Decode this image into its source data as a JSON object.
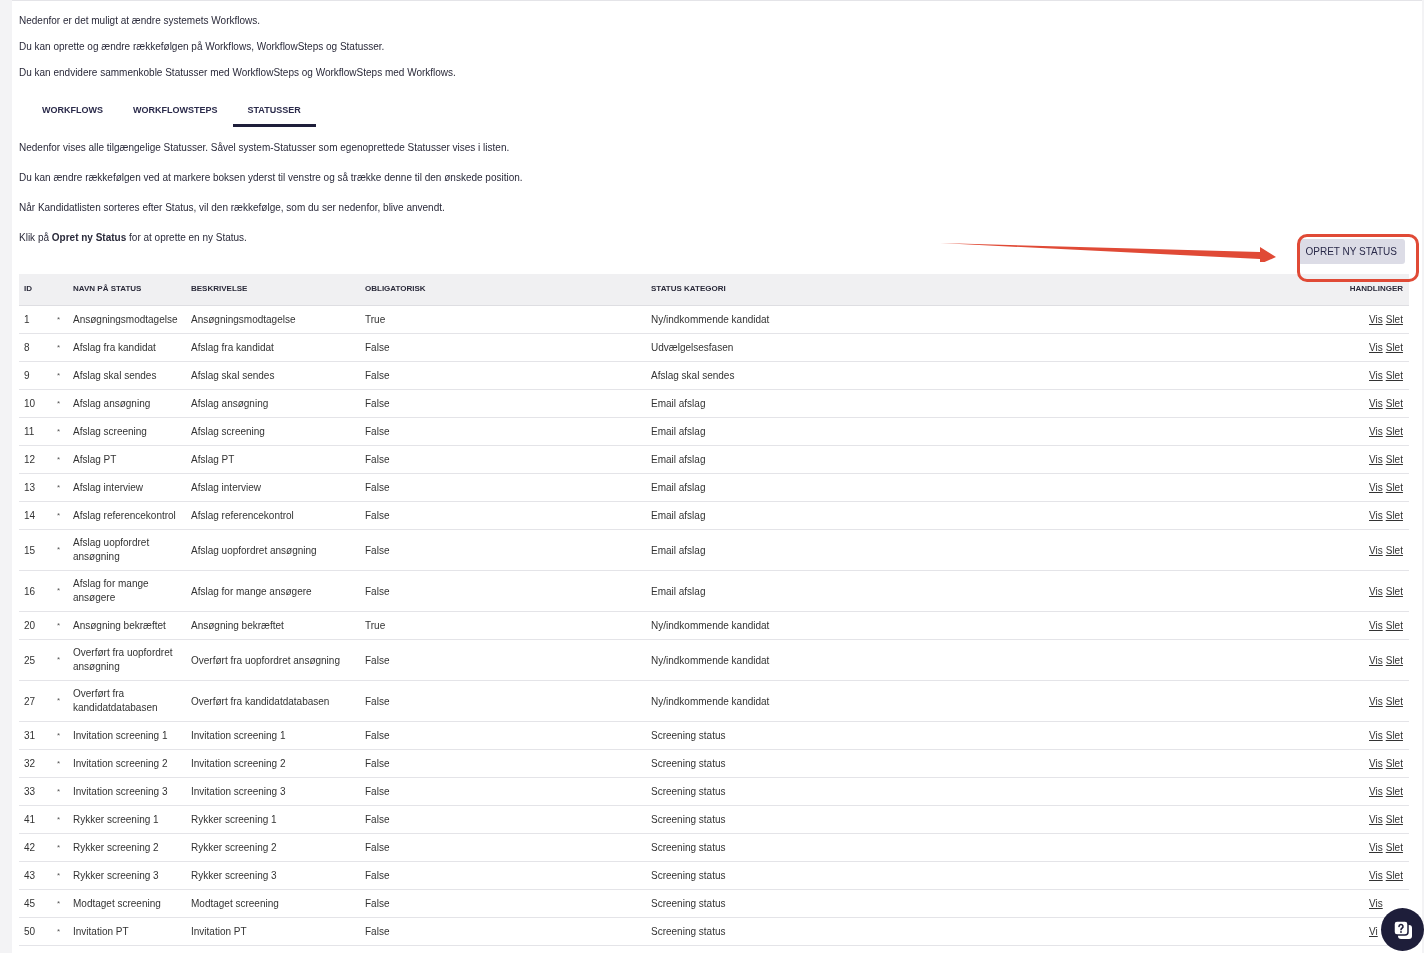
{
  "intro": [
    "Nedenfor er det muligt at ændre systemets Workflows.",
    "Du kan oprette og ændre rækkefølgen på Workflows, WorkflowSteps og Statusser.",
    "Du kan endvidere sammenkoble Statusser med WorkflowSteps og WorkflowSteps med Workflows."
  ],
  "tabs": [
    {
      "label": "WORKFLOWS",
      "selected": false
    },
    {
      "label": "WORKFLOWSTEPS",
      "selected": false
    },
    {
      "label": "STATUSSER",
      "selected": true
    }
  ],
  "description": [
    "Nedenfor vises alle tilgængelige Statusser. Såvel system-Statusser som egenoprettede Statusser vises i listen.",
    "Du kan ændre rækkefølgen ved at markere boksen yderst til venstre og så trække denne til den ønskede position.",
    "Når Kandidatlisten sorteres efter Status, vil den rækkefølge, som du ser nedenfor, blive anvendt.",
    "Klik på **Opret ny Status** for at oprette en ny Status."
  ],
  "create_button": "OPRET NY STATUS",
  "table": {
    "columns": [
      "ID",
      "NAVN PÅ STATUS",
      "BESKRIVELSE",
      "OBLIGATORISK",
      "STATUS KATEGORI",
      "HANDLINGER"
    ],
    "rows": [
      {
        "id": "1",
        "handle": "*",
        "name": "Ansøgningsmodtagelse",
        "description": "Ansøgningsmodtagelse",
        "mandatory": "True",
        "category": "Ny/indkommende kandidat",
        "actions": [
          "Vis",
          "Slet"
        ]
      },
      {
        "id": "8",
        "handle": "*",
        "name": "Afslag fra kandidat",
        "description": "Afslag fra kandidat",
        "mandatory": "False",
        "category": "Udvælgelsesfasen",
        "actions": [
          "Vis",
          "Slet"
        ]
      },
      {
        "id": "9",
        "handle": "*",
        "name": "Afslag skal sendes",
        "description": "Afslag skal sendes",
        "mandatory": "False",
        "category": "Afslag skal sendes",
        "actions": [
          "Vis",
          "Slet"
        ]
      },
      {
        "id": "10",
        "handle": "*",
        "name": "Afslag ansøgning",
        "description": "Afslag ansøgning",
        "mandatory": "False",
        "category": "Email afslag",
        "actions": [
          "Vis",
          "Slet"
        ]
      },
      {
        "id": "11",
        "handle": "*",
        "name": "Afslag screening",
        "description": "Afslag screening",
        "mandatory": "False",
        "category": "Email afslag",
        "actions": [
          "Vis",
          "Slet"
        ]
      },
      {
        "id": "12",
        "handle": "*",
        "name": "Afslag PT",
        "description": "Afslag PT",
        "mandatory": "False",
        "category": "Email afslag",
        "actions": [
          "Vis",
          "Slet"
        ]
      },
      {
        "id": "13",
        "handle": "*",
        "name": "Afslag interview",
        "description": "Afslag interview",
        "mandatory": "False",
        "category": "Email afslag",
        "actions": [
          "Vis",
          "Slet"
        ]
      },
      {
        "id": "14",
        "handle": "*",
        "name": "Afslag referencekontrol",
        "description": "Afslag referencekontrol",
        "mandatory": "False",
        "category": "Email afslag",
        "actions": [
          "Vis",
          "Slet"
        ]
      },
      {
        "id": "15",
        "handle": "*",
        "name": "Afslag uopfordret ansøgning",
        "description": "Afslag uopfordret ansøgning",
        "mandatory": "False",
        "category": "Email afslag",
        "actions": [
          "Vis",
          "Slet"
        ]
      },
      {
        "id": "16",
        "handle": "*",
        "name": "Afslag for mange ansøgere",
        "description": "Afslag for mange ansøgere",
        "mandatory": "False",
        "category": "Email afslag",
        "actions": [
          "Vis",
          "Slet"
        ]
      },
      {
        "id": "20",
        "handle": "*",
        "name": "Ansøgning bekræftet",
        "description": "Ansøgning bekræftet",
        "mandatory": "True",
        "category": "Ny/indkommende kandidat",
        "actions": [
          "Vis",
          "Slet"
        ]
      },
      {
        "id": "25",
        "handle": "*",
        "name": "Overført fra uopfordret ansøgning",
        "description": "Overført fra uopfordret ansøgning",
        "mandatory": "False",
        "category": "Ny/indkommende kandidat",
        "actions": [
          "Vis",
          "Slet"
        ]
      },
      {
        "id": "27",
        "handle": "*",
        "name": "Overført fra kandidatdatabasen",
        "description": "Overført fra kandidatdatabasen",
        "mandatory": "False",
        "category": "Ny/indkommende kandidat",
        "actions": [
          "Vis",
          "Slet"
        ]
      },
      {
        "id": "31",
        "handle": "*",
        "name": "Invitation screening 1",
        "description": "Invitation screening 1",
        "mandatory": "False",
        "category": "Screening status",
        "actions": [
          "Vis",
          "Slet"
        ]
      },
      {
        "id": "32",
        "handle": "*",
        "name": "Invitation screening 2",
        "description": "Invitation screening 2",
        "mandatory": "False",
        "category": "Screening status",
        "actions": [
          "Vis",
          "Slet"
        ]
      },
      {
        "id": "33",
        "handle": "*",
        "name": "Invitation screening 3",
        "description": "Invitation screening 3",
        "mandatory": "False",
        "category": "Screening status",
        "actions": [
          "Vis",
          "Slet"
        ]
      },
      {
        "id": "41",
        "handle": "*",
        "name": "Rykker screening 1",
        "description": "Rykker screening 1",
        "mandatory": "False",
        "category": "Screening status",
        "actions": [
          "Vis",
          "Slet"
        ]
      },
      {
        "id": "42",
        "handle": "*",
        "name": "Rykker screening 2",
        "description": "Rykker screening 2",
        "mandatory": "False",
        "category": "Screening status",
        "actions": [
          "Vis",
          "Slet"
        ]
      },
      {
        "id": "43",
        "handle": "*",
        "name": "Rykker screening 3",
        "description": "Rykker screening 3",
        "mandatory": "False",
        "category": "Screening status",
        "actions": [
          "Vis",
          "Slet"
        ]
      },
      {
        "id": "45",
        "handle": "*",
        "name": "Modtaget screening",
        "description": "Modtaget screening",
        "mandatory": "False",
        "category": "Screening status",
        "actions": [
          "Vis"
        ]
      },
      {
        "id": "50",
        "handle": "*",
        "name": "Invitation PT",
        "description": "Invitation PT",
        "mandatory": "False",
        "category": "Screening status",
        "actions": [
          "Vi"
        ]
      }
    ]
  }
}
